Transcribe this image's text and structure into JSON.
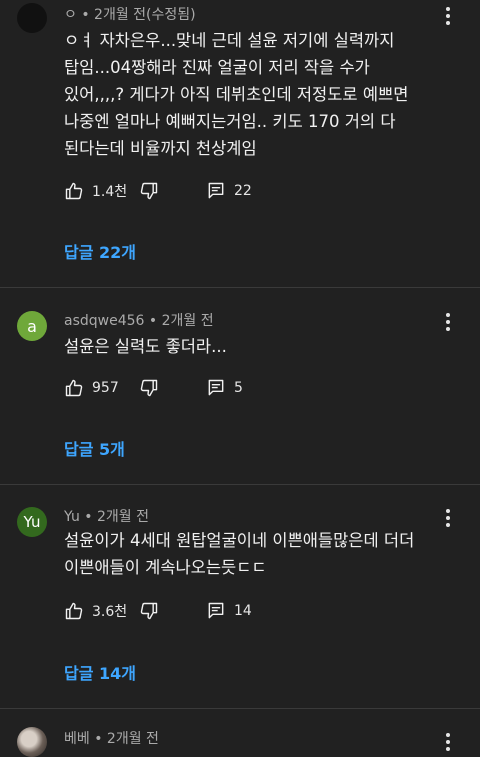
{
  "comments": [
    {
      "avatar_letter": "",
      "avatar_color": "#111111",
      "meta": "ㅇ • 2개월 전(수정됨)",
      "lines": [
        "ㅇㅕ 자차은우...맞네 근데 설윤 저기에 실력까지",
        "탑임...04짱해라 진짜 얼굴이 저리 작을 수가",
        "있어,,,,? 게다가 아직 데뷔초인데 저정도로 예쁘면",
        "나중엔 얼마나 예뻐지는거임.. 키도 170 거의 다",
        "된다는데 비율까지 천상계임"
      ],
      "likes": "1.4천",
      "reply_count": "22",
      "replies_label": "답글 22개"
    },
    {
      "avatar_letter": "a",
      "avatar_color": "#6fa83a",
      "meta": "asdqwe456 • 2개월 전",
      "lines": [
        "설윤은 실력도 좋더라..."
      ],
      "likes": "957",
      "reply_count": "5",
      "replies_label": "답글 5개"
    },
    {
      "avatar_letter": "Yu",
      "avatar_color": "#33691e",
      "meta": "Yu • 2개월 전",
      "lines": [
        "설윤이가 4세대 원탑얼굴이네 이쁜애들많은데 더더",
        "이쁜애들이 계속나오는듯ㄷㄷ"
      ],
      "likes": "3.6천",
      "reply_count": "14",
      "replies_label": "답글 14개"
    },
    {
      "avatar_letter": "",
      "avatar_color": "#9a8f86",
      "meta": "베베 • 2개월 전",
      "lines": [],
      "likes": "",
      "reply_count": "",
      "replies_label": ""
    }
  ]
}
